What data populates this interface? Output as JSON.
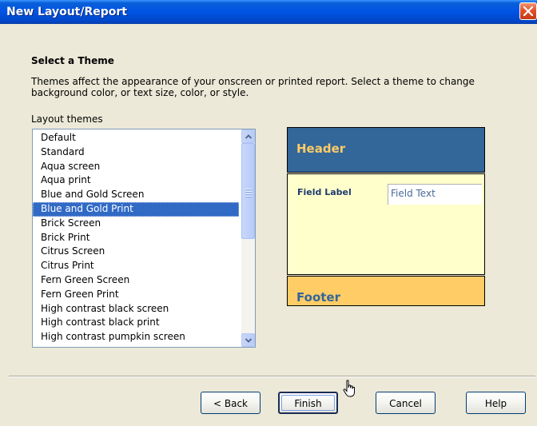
{
  "window": {
    "title": "New Layout/Report"
  },
  "content": {
    "heading": "Select a Theme",
    "description_line1": "Themes affect the appearance of your onscreen or printed report. Select a theme to change",
    "description_line2": "background color, or text size, color, or style.",
    "list_label": "Layout themes"
  },
  "themes": {
    "selected": "Blue and Gold Print",
    "items": [
      "Default",
      "Standard",
      "Aqua screen",
      "Aqua print",
      "Blue and Gold Screen",
      "Blue and Gold Print",
      "Brick Screen",
      "Brick Print",
      "Citrus Screen",
      "Citrus Print",
      "Fern Green Screen",
      "Fern Green Print",
      "High contrast black screen",
      "High contrast black print",
      "High contrast pumpkin screen"
    ]
  },
  "preview": {
    "header": "Header",
    "field_label": "Field Label",
    "field_text": "Field Text",
    "footer": "Footer",
    "colors": {
      "header_bg": "#336699",
      "header_text": "#ffcc66",
      "body_bg": "#ffffcc",
      "footer_bg": "#ffcc66",
      "footer_text": "#336699"
    }
  },
  "buttons": {
    "back": "< Back",
    "finish": "Finish",
    "cancel": "Cancel",
    "help": "Help"
  }
}
